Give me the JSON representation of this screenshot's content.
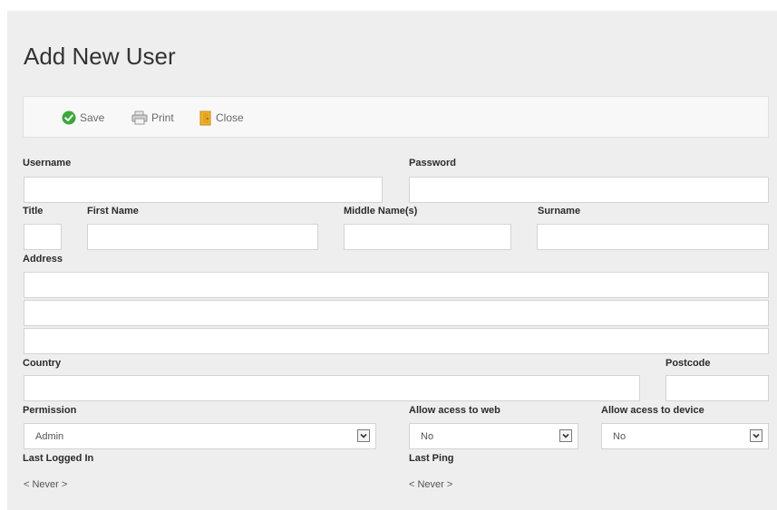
{
  "header": {
    "title": "Add New User"
  },
  "toolbar": {
    "save": "Save",
    "print": "Print",
    "close": "Close"
  },
  "form": {
    "username": {
      "label": "Username",
      "value": ""
    },
    "password": {
      "label": "Password",
      "value": ""
    },
    "title_field": {
      "label": "Title",
      "value": ""
    },
    "first_name": {
      "label": "First Name",
      "value": ""
    },
    "middle_name": {
      "label": "Middle Name(s)",
      "value": ""
    },
    "surname": {
      "label": "Surname",
      "value": ""
    },
    "address": {
      "label": "Address",
      "lines": [
        "",
        "",
        ""
      ]
    },
    "country": {
      "label": "Country",
      "value": ""
    },
    "postcode": {
      "label": "Postcode",
      "value": ""
    },
    "permission": {
      "label": "Permission",
      "selected": "Admin"
    },
    "allow_web": {
      "label": "Allow acess to web",
      "selected": "No"
    },
    "allow_device": {
      "label": "Allow acess to device",
      "selected": "No"
    },
    "last_logged_in": {
      "label": "Last Logged In",
      "value": "< Never >"
    },
    "last_ping": {
      "label": "Last Ping",
      "value": "< Never >"
    }
  },
  "icons": {
    "save": "check-circle-icon",
    "print": "printer-icon",
    "close": "door-exit-icon"
  },
  "colors": {
    "accent_green": "#3aa83a",
    "close_orange": "#e8a21c",
    "panel_bg": "#eeeeee"
  }
}
